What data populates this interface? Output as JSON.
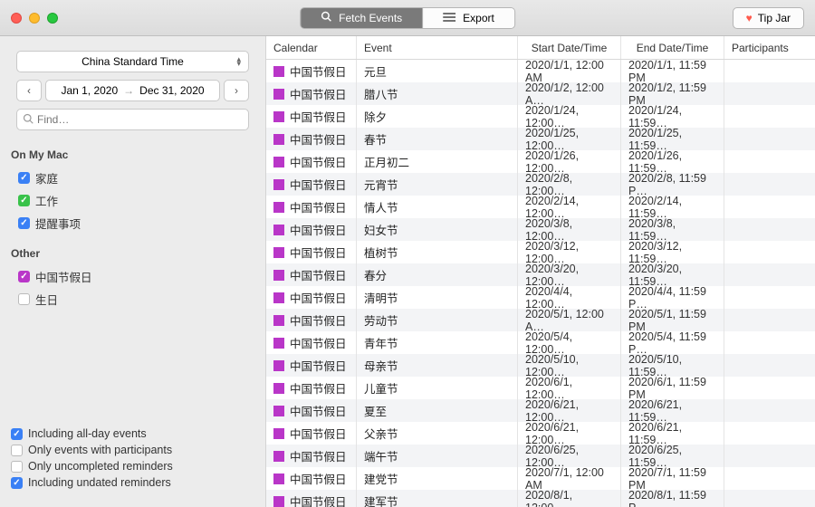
{
  "toolbar": {
    "fetch": "Fetch Events",
    "export": "Export",
    "tipjar": "Tip Jar"
  },
  "sidebar": {
    "timezone": "China Standard Time",
    "date_from": "Jan 1, 2020",
    "date_to": "Dec 31, 2020",
    "search_placeholder": "Find…",
    "sections": [
      {
        "title": "On My Mac",
        "items": [
          {
            "label": "家庭",
            "color": "#3a80f5",
            "checked": true
          },
          {
            "label": "工作",
            "color": "#39c24a",
            "checked": true
          },
          {
            "label": "提醒事项",
            "color": "#3a80f5",
            "checked": true
          }
        ]
      },
      {
        "title": "Other",
        "items": [
          {
            "label": "中国节假日",
            "color": "#b936c8",
            "checked": true
          },
          {
            "label": "生日",
            "color": "#ffffff",
            "checked": false
          }
        ]
      }
    ],
    "filters": [
      {
        "label": "Including all-day events",
        "checked": true
      },
      {
        "label": "Only events with participants",
        "checked": false
      },
      {
        "label": "Only uncompleted reminders",
        "checked": false
      },
      {
        "label": "Including undated reminders",
        "checked": true
      }
    ]
  },
  "table": {
    "headers": {
      "cal": "Calendar",
      "event": "Event",
      "start": "Start Date/Time",
      "end": "End Date/Time",
      "part": "Participants"
    },
    "cal_label": "中国节假日",
    "rows": [
      {
        "event": "元旦",
        "start": "2020/1/1, 12:00 AM",
        "end": "2020/1/1, 11:59 PM"
      },
      {
        "event": "腊八节",
        "start": "2020/1/2, 12:00 A…",
        "end": "2020/1/2, 11:59 PM"
      },
      {
        "event": "除夕",
        "start": "2020/1/24, 12:00…",
        "end": "2020/1/24, 11:59…"
      },
      {
        "event": "春节",
        "start": "2020/1/25, 12:00…",
        "end": "2020/1/25, 11:59…"
      },
      {
        "event": "正月初二",
        "start": "2020/1/26, 12:00…",
        "end": "2020/1/26, 11:59…"
      },
      {
        "event": "元宵节",
        "start": "2020/2/8, 12:00…",
        "end": "2020/2/8, 11:59 P…"
      },
      {
        "event": "情人节",
        "start": "2020/2/14, 12:00…",
        "end": "2020/2/14, 11:59…"
      },
      {
        "event": "妇女节",
        "start": "2020/3/8, 12:00…",
        "end": "2020/3/8, 11:59…"
      },
      {
        "event": "植树节",
        "start": "2020/3/12, 12:00…",
        "end": "2020/3/12, 11:59…"
      },
      {
        "event": "春分",
        "start": "2020/3/20, 12:00…",
        "end": "2020/3/20, 11:59…"
      },
      {
        "event": "清明节",
        "start": "2020/4/4, 12:00…",
        "end": "2020/4/4, 11:59 P…"
      },
      {
        "event": "劳动节",
        "start": "2020/5/1, 12:00 A…",
        "end": "2020/5/1, 11:59 PM"
      },
      {
        "event": "青年节",
        "start": "2020/5/4, 12:00…",
        "end": "2020/5/4, 11:59 P…"
      },
      {
        "event": "母亲节",
        "start": "2020/5/10, 12:00…",
        "end": "2020/5/10, 11:59…"
      },
      {
        "event": "儿童节",
        "start": "2020/6/1, 12:00…",
        "end": "2020/6/1, 11:59 PM"
      },
      {
        "event": "夏至",
        "start": "2020/6/21, 12:00…",
        "end": "2020/6/21, 11:59…"
      },
      {
        "event": "父亲节",
        "start": "2020/6/21, 12:00…",
        "end": "2020/6/21, 11:59…"
      },
      {
        "event": "端午节",
        "start": "2020/6/25, 12:00…",
        "end": "2020/6/25, 11:59…"
      },
      {
        "event": "建党节",
        "start": "2020/7/1, 12:00 AM",
        "end": "2020/7/1, 11:59 PM"
      },
      {
        "event": "建军节",
        "start": "2020/8/1, 12:00…",
        "end": "2020/8/1, 11:59 P…"
      }
    ]
  }
}
